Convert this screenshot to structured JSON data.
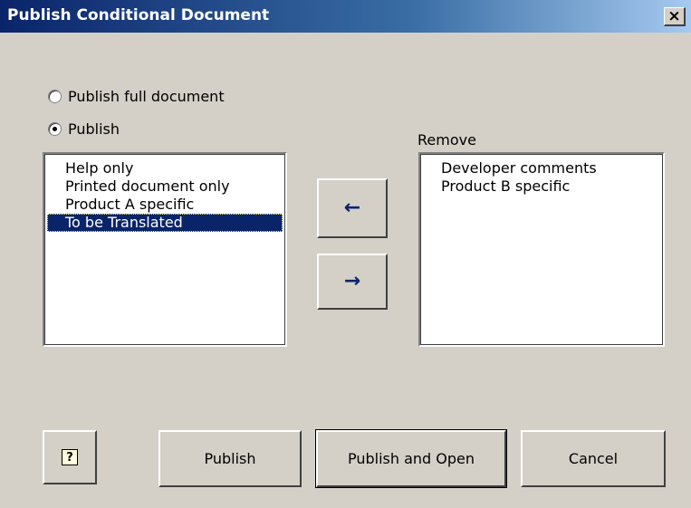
{
  "window": {
    "title": "Publish Conditional Document",
    "close_glyph": "×"
  },
  "options": {
    "full_label": "Publish full document",
    "publish_label": "Publish",
    "selected": "publish"
  },
  "publish_list": {
    "items": [
      "Help only",
      "Printed document only",
      "Product A specific",
      "To be Translated"
    ],
    "selected_index": 3
  },
  "remove_list": {
    "label": "Remove",
    "items": [
      "Developer comments",
      "Product B specific"
    ]
  },
  "move_buttons": {
    "left_icon": "arrow-left-icon",
    "left_glyph": "←",
    "right_icon": "arrow-right-icon",
    "right_glyph": "→"
  },
  "footer": {
    "help_icon": "help-icon",
    "help_glyph": "?",
    "publish_label": "Publish",
    "publish_open_label": "Publish and Open",
    "cancel_label": "Cancel"
  },
  "colors": {
    "face": "#d4d0c8",
    "title_start": "#0a246a",
    "title_end": "#a6caf0",
    "selection": "#0a246a"
  }
}
